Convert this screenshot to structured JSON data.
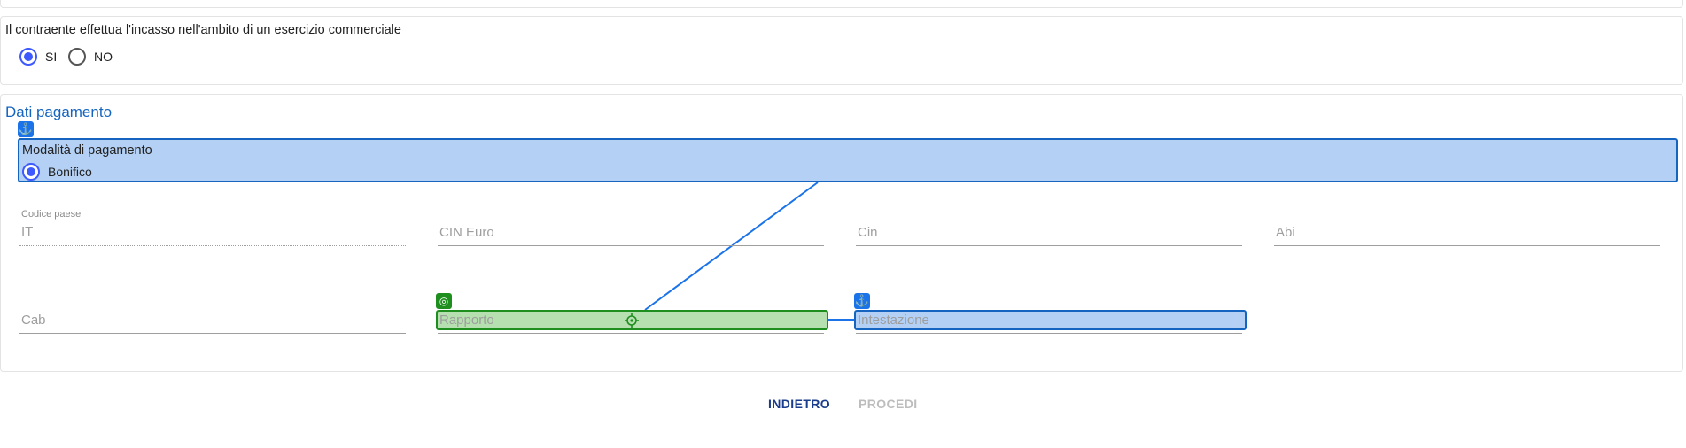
{
  "question": {
    "text": "Il contraente effettua l'incasso nell'ambito di un esercizio commerciale",
    "options": [
      {
        "label": "SI",
        "selected": true
      },
      {
        "label": "NO",
        "selected": false
      }
    ]
  },
  "payment": {
    "section_title": "Dati pagamento",
    "method_label": "Modalità di pagamento",
    "method_option": "Bonifico",
    "fields": {
      "codice_paese": {
        "label": "Codice paese",
        "value": "IT"
      },
      "cin_euro": {
        "placeholder": "CIN Euro"
      },
      "cin": {
        "placeholder": "Cin"
      },
      "abi": {
        "placeholder": "Abi"
      },
      "cab": {
        "placeholder": "Cab"
      },
      "rapporto": {
        "placeholder": "Rapporto"
      },
      "intestazione": {
        "placeholder": "Intestazione"
      }
    }
  },
  "overlay": {
    "anchor_icon": "anchor-icon",
    "target_icon": "target-icon",
    "crosshair_icon": "crosshair-icon",
    "anchor_color": "#1a73e8",
    "target_color": "#1e8e1e"
  },
  "actions": {
    "back_label": "INDIETRO",
    "next_label": "PROCEDI"
  },
  "colors": {
    "accent": "#3d5afe",
    "title": "#1565c0",
    "highlight_blue": "#b4d1f5",
    "highlight_green": "#b6e0b0"
  }
}
